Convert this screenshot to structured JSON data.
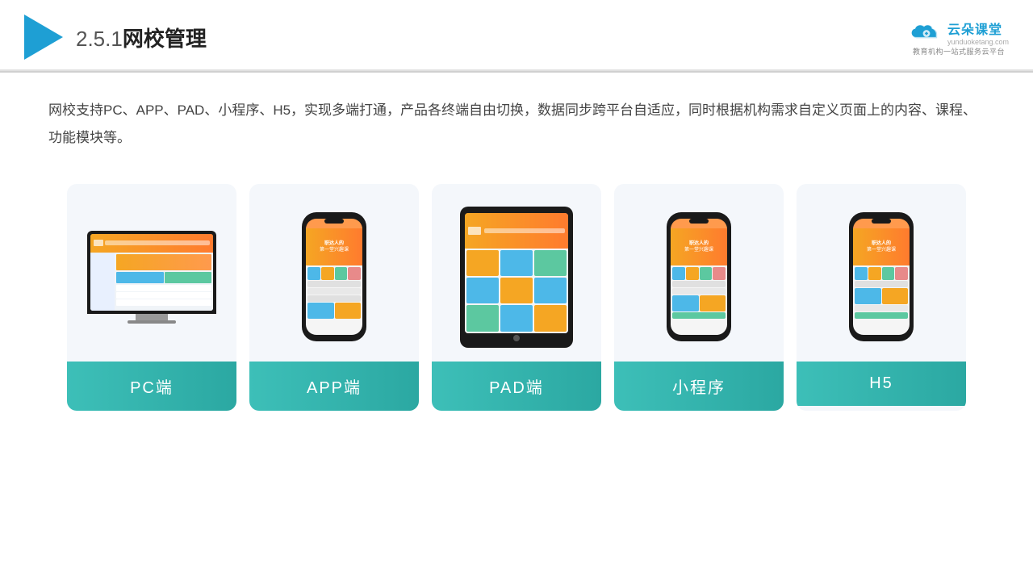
{
  "header": {
    "title_number": "2.5.1",
    "title_text": "网校管理",
    "brand_name": "云朵课堂",
    "brand_url": "yunduoketang.com",
    "brand_tagline": "教育机构一站式服务云平台"
  },
  "description": {
    "text": "网校支持PC、APP、PAD、小程序、H5，实现多端打通，产品各终端自由切换，数据同步跨平台自适应，同时根据机构需求自定义页面上的内容、课程、功能模块等。"
  },
  "cards": [
    {
      "id": "pc",
      "label": "PC端",
      "type": "pc"
    },
    {
      "id": "app",
      "label": "APP端",
      "type": "phone"
    },
    {
      "id": "pad",
      "label": "PAD端",
      "type": "ipad"
    },
    {
      "id": "miniapp",
      "label": "小程序",
      "type": "phone"
    },
    {
      "id": "h5",
      "label": "H5",
      "type": "phone"
    }
  ]
}
